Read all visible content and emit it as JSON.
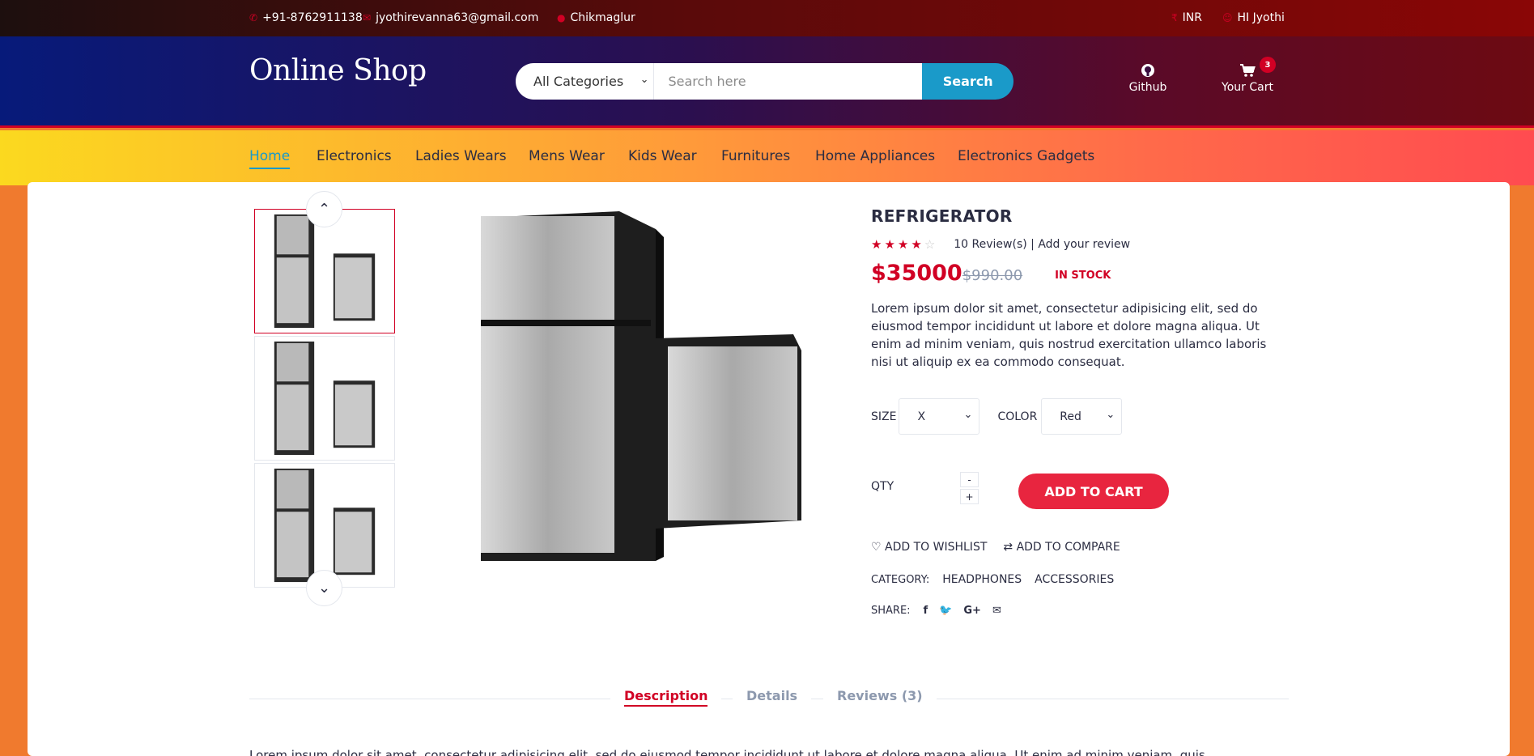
{
  "topbar": {
    "phone": "+91-8762911138",
    "email": "jyothirevanna63@gmail.com",
    "location": "Chikmaglur",
    "currency": "INR",
    "greeting": "HI Jyothi"
  },
  "header": {
    "logo": "Online Shop",
    "category_select": "All Categories",
    "search_placeholder": "Search here",
    "search_button": "Search",
    "github_label": "Github",
    "cart_label": "Your Cart",
    "cart_count": "3"
  },
  "nav": {
    "items": [
      "Home",
      "Electronics",
      "Ladies Wears",
      "Mens Wear",
      "Kids Wear",
      "Furnitures",
      "Home Appliances",
      "Electronics Gadgets"
    ]
  },
  "product": {
    "name": "REFRIGERATOR",
    "rating": 4,
    "rating_max": 5,
    "review_link": "10 Review(s) | Add your review",
    "price": "$35000",
    "old_price": "$990.00",
    "stock": "IN STOCK",
    "description": "Lorem ipsum dolor sit amet, consectetur adipisicing elit, sed do eiusmod tempor incididunt ut labore et dolore magna aliqua. Ut enim ad minim veniam, quis nostrud exercitation ullamco laboris nisi ut aliquip ex ea commodo consequat.",
    "size_label": "SIZE",
    "size_value": "X",
    "color_label": "COLOR",
    "color_value": "Red",
    "qty_label": "QTY",
    "qty_minus": "-",
    "qty_plus": "+",
    "add_to_cart": "ADD TO CART",
    "wishlist": "ADD TO WISHLIST",
    "compare": "ADD TO COMPARE",
    "category_label": "CATEGORY:",
    "categories": [
      "HEADPHONES",
      "ACCESSORIES"
    ],
    "share_label": "SHARE:",
    "share_icons": [
      "facebook-icon",
      "twitter-icon",
      "google-plus-icon",
      "email-icon"
    ]
  },
  "tabs": {
    "items": [
      "Description",
      "Details",
      "Reviews (3)"
    ],
    "active": "Description",
    "content": "Lorem ipsum dolor sit amet, consectetur adipisicing elit, sed do eiusmod tempor incididunt ut labore et dolore magna aliqua. Ut enim ad minim veniam, quis"
  },
  "colors": {
    "accent": "#d10024",
    "link": "#1a9ac9",
    "search_button": "#1a9ac9",
    "add_to_cart": "#e8253f"
  }
}
